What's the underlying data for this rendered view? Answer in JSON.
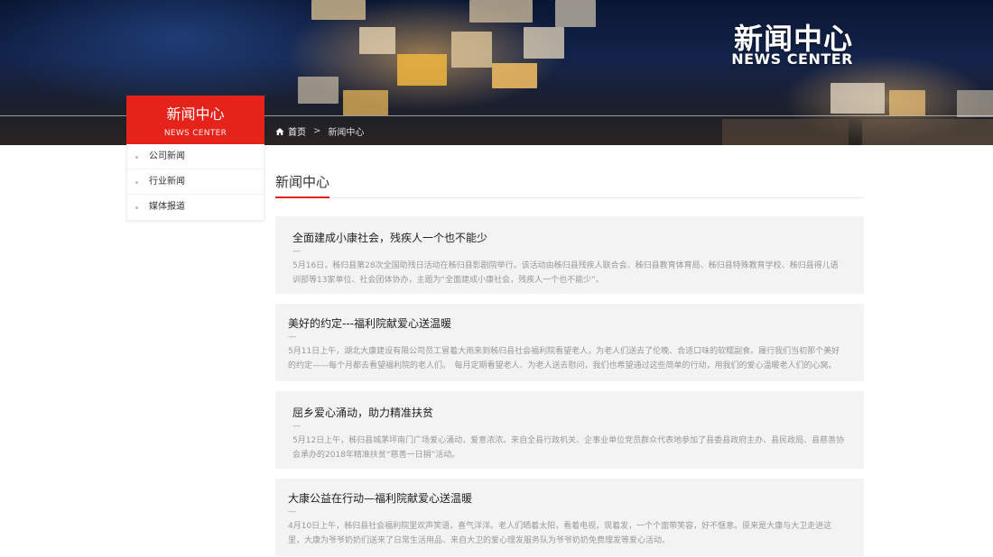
{
  "banner": {
    "title_cn": "新闻中心",
    "title_en": "NEWS CENTER"
  },
  "breadcrumb": {
    "home": "首页",
    "separator": ">",
    "current": "新闻中心"
  },
  "sidebar": {
    "title_cn": "新闻中心",
    "title_en": "NEWS CENTER",
    "items": [
      {
        "label": "公司新闻"
      },
      {
        "label": "行业新闻"
      },
      {
        "label": "媒体报道"
      }
    ]
  },
  "main": {
    "section_title": "新闻中心",
    "news": [
      {
        "title": "全面建成小康社会，残疾人一个也不能少",
        "dash": "—",
        "desc": "5月16日，秭归县第28次全国助残日活动在秭归县影剧院举行。该活动由秭归县残疾人联合会、秭归县教育体育局、秭归县特殊教育学校、秭归县得儿语训部等13家单位、社会团体协办，主题为“全面建成小康社会，残疾人一个也不能少”。"
      },
      {
        "title": "美好的约定---福利院献爱心送温暖",
        "dash": "—",
        "desc": "5月11日上午，湖北大康建设有限公司员工冒着大雨来到秭归县社会福利院看望老人，为老人们送去了伦晚、合适口味的软糯副食。履行我们当初那个美好的约定——每个月都去看望福利院的老人们。　每月定期看望老人、为老人送去慰问，我们也希望通过这些简单的行动，用我们的爱心温暖老人们的心窝。"
      },
      {
        "title": "屈乡爱心涌动，助力精准扶贫",
        "dash": "—",
        "desc": "5月12日上午，秭归县城茅坪南门广场爱心涌动，爱意浓浓。来自全县行政机关、企事业单位党员群众代表地参加了县委县政府主办、县民政局、县慈善协会承办的2018年精准扶贫“慈善一日捐”活动。"
      },
      {
        "title": "大康公益在行动—福利院献爱心送温暖",
        "dash": "—",
        "desc": "4月10日上午，秭归县社会福利院里欢声笑语，喜气洋洋。老人们晒着太阳，看着电视，现着发，一个个面带笑容，好不惬意。原来是大康与大卫走进这里，大康为爷爷奶奶们送来了日常生活用品、来自大卫的爱心理发服务队为爷爷奶奶免费理发等爱心活动。"
      }
    ]
  }
}
